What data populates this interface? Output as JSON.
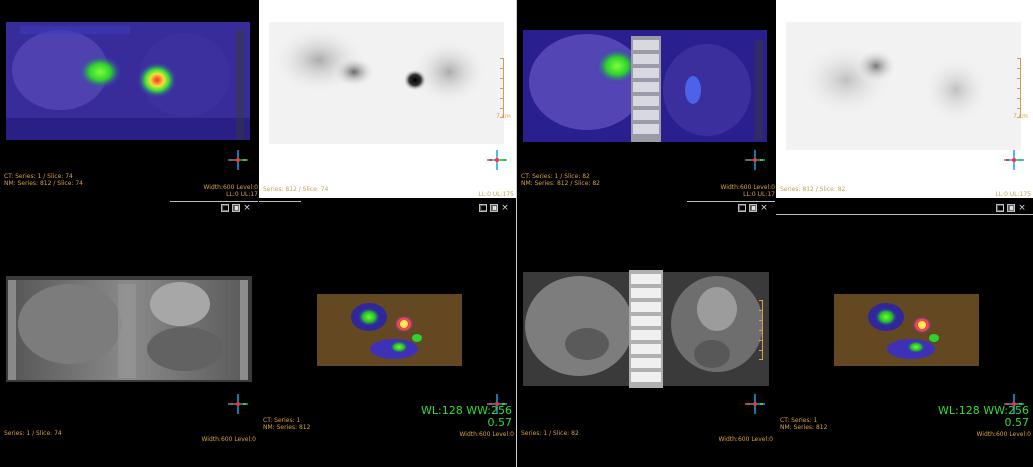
{
  "left": {
    "fused": {
      "ct_line": "CT: Series: 1 / Slice: 74",
      "nm_line": "NM: Series: 812 / Slice: 74",
      "width_level": "Width:600 Level:0",
      "ll_ul": "LL:0 UL:17"
    },
    "pet": {
      "series_line": "Series: 812 / Slice: 74",
      "ll_ul": "LL:0 UL:175",
      "cm": "7 cm"
    },
    "ct": {
      "series_line": "Series: 1 / Slice: 74",
      "width_level": "Width:600 Level:0"
    },
    "mip": {
      "ct_series": "CT: Series: 1",
      "nm_series": "NM: Series: 812",
      "wl_ww": "WL:128 WW:256",
      "zoom": "0.57",
      "width_level": "Width:600 Level:0"
    }
  },
  "right": {
    "fused": {
      "ct_line": "CT: Series: 1 / Slice: 82",
      "nm_line": "NM: Series: 812 / Slice: 82",
      "width_level": "Width:600 Level:0",
      "ll_ul": "LL:0 UL:17"
    },
    "pet": {
      "series_line": "Series: 812 / Slice: 82",
      "ll_ul": "LL:0 UL:175",
      "cm": "7 cm"
    },
    "ct": {
      "series_line": "Series: 1 / Slice: 82",
      "width_level": "Width:600 Level:0"
    },
    "mip": {
      "ct_series": "CT: Series: 1",
      "nm_series": "NM: Series: 812",
      "wl_ww": "WL:128 WW:256",
      "zoom": "0.57",
      "width_level": "Width:600 Level:0"
    }
  },
  "window_controls": {
    "restore": "□",
    "maximize": "▣",
    "close": "×"
  },
  "colors": {
    "overlay_text": "#d9a044",
    "wl_text": "#2fdc2f",
    "pet_hot": "#ff3030",
    "pet_mid": "#38e838",
    "pet_low": "#3a2fc8"
  },
  "icons": {
    "orientation": "orientation-cross-icon"
  }
}
